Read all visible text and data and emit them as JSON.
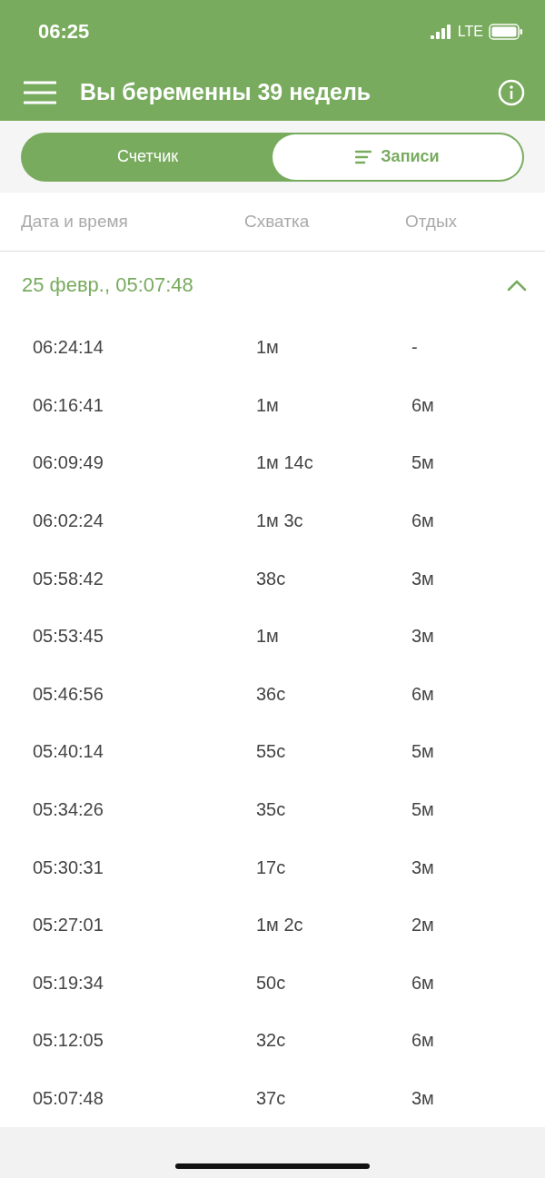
{
  "status_bar": {
    "time": "06:25",
    "network": "LTE"
  },
  "header": {
    "title": "Вы беременны 39 недель"
  },
  "tabs": [
    {
      "label": "Счетчик",
      "selected": false
    },
    {
      "label": "Записи",
      "selected": true
    }
  ],
  "table": {
    "columns": [
      "Дата и время",
      "Схватка",
      "Отдых"
    ],
    "groups": [
      {
        "title": "25 февр., 05:07:48",
        "expanded": true,
        "rows": [
          [
            "06:24:14",
            "1м",
            "-"
          ],
          [
            "06:16:41",
            "1м",
            "6м"
          ],
          [
            "06:09:49",
            "1м 14с",
            "5м"
          ],
          [
            "06:02:24",
            "1м 3с",
            "6м"
          ],
          [
            "05:58:42",
            "38с",
            "3м"
          ],
          [
            "05:53:45",
            "1м",
            "3м"
          ],
          [
            "05:46:56",
            "36с",
            "6м"
          ],
          [
            "05:40:14",
            "55с",
            "5м"
          ],
          [
            "05:34:26",
            "35с",
            "5м"
          ],
          [
            "05:30:31",
            "17с",
            "3м"
          ],
          [
            "05:27:01",
            "1м 2с",
            "2м"
          ],
          [
            "05:19:34",
            "50с",
            "6м"
          ],
          [
            "05:12:05",
            "32с",
            "6м"
          ],
          [
            "05:07:48",
            "37с",
            "3м"
          ]
        ]
      }
    ]
  }
}
